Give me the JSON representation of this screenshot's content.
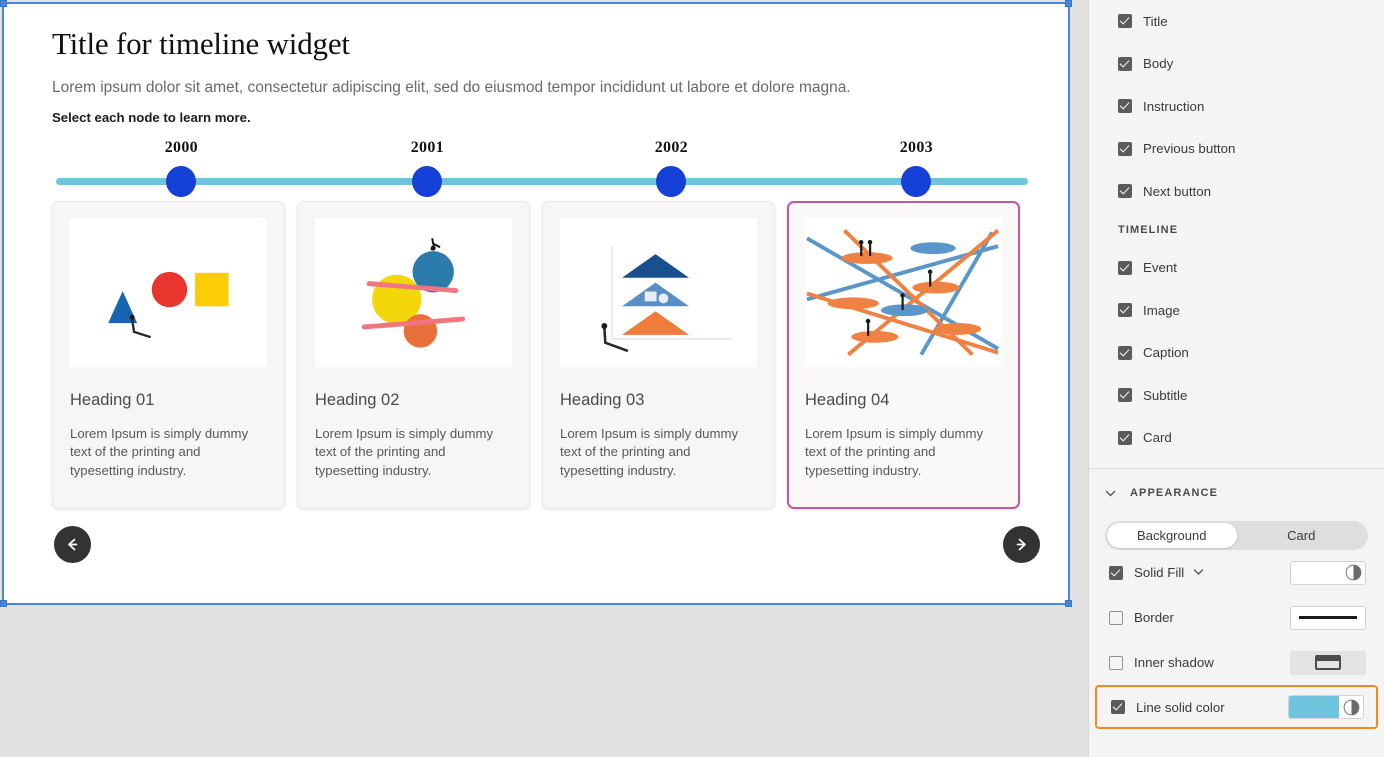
{
  "widget": {
    "title": "Title for timeline widget",
    "body": "Lorem ipsum dolor sit amet, consectetur adipiscing elit, sed do eiusmod tempor incididunt ut labore et dolore magna.",
    "instruction": "Select each node to learn more.",
    "line_color": "#6ec4dd",
    "node_color": "#1540d8",
    "selected_card_border": "#c4589b",
    "selection_border": "#4a85db"
  },
  "timeline": {
    "nodes": [
      {
        "year": "2000",
        "x_pct": 13.2
      },
      {
        "year": "2001",
        "x_pct": 38.3
      },
      {
        "year": "2002",
        "x_pct": 63.2
      },
      {
        "year": "2003",
        "x_pct": 88.2
      }
    ]
  },
  "cards": [
    {
      "heading": "Heading 01",
      "text": "Lorem Ipsum is simply dummy text of the printing and typesetting industry.",
      "image": "shapes-triangle-circle-square",
      "selected": false
    },
    {
      "heading": "Heading 02",
      "text": "Lorem Ipsum is simply dummy text of the printing and typesetting industry.",
      "image": "balancing-balls",
      "selected": false
    },
    {
      "heading": "Heading 03",
      "text": "Lorem Ipsum is simply dummy text of the printing and typesetting industry.",
      "image": "stacked-triangles",
      "selected": false
    },
    {
      "heading": "Heading 04",
      "text": "Lorem Ipsum is simply dummy text of the printing and typesetting industry.",
      "image": "crossing-paths",
      "selected": true
    }
  ],
  "nav": {
    "prev_icon": "arrow-left-icon",
    "next_icon": "arrow-right-icon"
  },
  "panel": {
    "visibility_options": [
      {
        "label": "Title",
        "checked": true
      },
      {
        "label": "Body",
        "checked": true
      },
      {
        "label": "Instruction",
        "checked": true
      },
      {
        "label": "Previous button",
        "checked": true
      },
      {
        "label": "Next button",
        "checked": true
      }
    ],
    "timeline_section": {
      "heading": "TIMELINE",
      "options": [
        {
          "label": "Event",
          "checked": true
        },
        {
          "label": "Image",
          "checked": true
        },
        {
          "label": "Caption",
          "checked": true
        },
        {
          "label": "Subtitle",
          "checked": true
        },
        {
          "label": "Card",
          "checked": true
        }
      ]
    },
    "appearance": {
      "heading": "APPEARANCE",
      "collapse_icon": "chevron-down-icon",
      "tabs": [
        {
          "label": "Background",
          "active": true
        },
        {
          "label": "Card",
          "active": false
        }
      ],
      "rows": [
        {
          "label": "Solid Fill",
          "checked": true,
          "has_dropdown": true,
          "control": "color-swatch",
          "color": "#ffffff"
        },
        {
          "label": "Border",
          "checked": false,
          "has_dropdown": false,
          "control": "line-preview",
          "color": "#1a1a1a"
        },
        {
          "label": "Inner shadow",
          "checked": false,
          "has_dropdown": false,
          "control": "shadow-preview",
          "color": "#4c4c4c"
        },
        {
          "label": "Line solid color",
          "checked": true,
          "has_dropdown": false,
          "control": "color-swatch",
          "color": "#6ec4dd",
          "highlighted": true
        }
      ],
      "highlight_color": "#f08a1e"
    }
  }
}
